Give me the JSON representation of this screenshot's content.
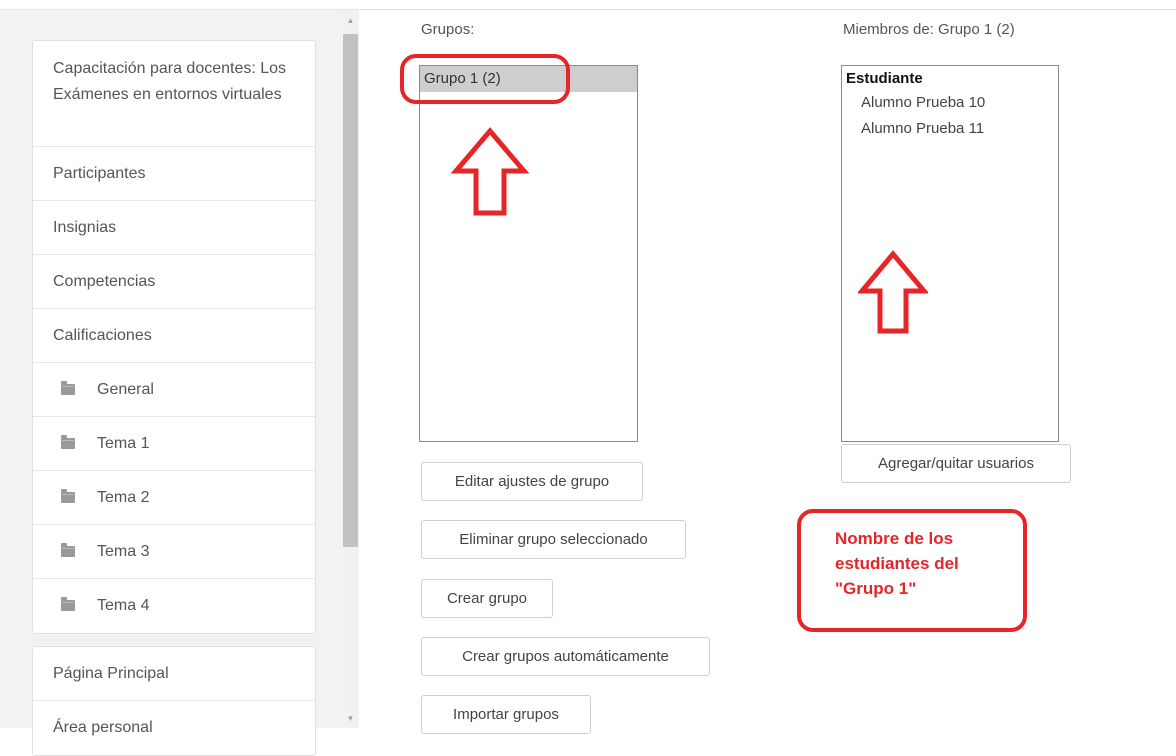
{
  "sidebar": {
    "course_title": "Capacitación para docentes: Los Exámenes en entornos virtuales",
    "items": [
      {
        "label": "Participantes"
      },
      {
        "label": "Insignias"
      },
      {
        "label": "Competencias"
      },
      {
        "label": "Calificaciones"
      }
    ],
    "sections": [
      {
        "label": "General",
        "icon": "folder-icon"
      },
      {
        "label": "Tema 1",
        "icon": "folder-icon"
      },
      {
        "label": "Tema 2",
        "icon": "folder-icon"
      },
      {
        "label": "Tema 3",
        "icon": "folder-icon"
      },
      {
        "label": "Tema 4",
        "icon": "folder-icon"
      }
    ],
    "bottom_items": [
      {
        "label": "Página Principal"
      },
      {
        "label": "Área personal"
      }
    ]
  },
  "groups": {
    "label": "Grupos:",
    "options": [
      {
        "label": "Grupo 1 (2)",
        "selected": true
      }
    ]
  },
  "members": {
    "label": "Miembros de: Grupo 1 (2)",
    "role": "Estudiante",
    "users": [
      "Alumno Prueba 10",
      "Alumno Prueba 11"
    ],
    "add_remove_button": "Agregar/quitar usuarios"
  },
  "buttons": {
    "edit": "Editar ajustes de grupo",
    "delete": "Eliminar grupo seleccionado",
    "create": "Crear grupo",
    "auto_create": "Crear grupos automáticamente",
    "import": "Importar grupos"
  },
  "annotation": {
    "line1": "Nombre de los",
    "line2": "estudiantes del",
    "line3": "\"Grupo 1\"",
    "color": "#e52528"
  },
  "scrollbar": {
    "up_icon": "scroll-up-arrow-icon",
    "down_icon": "scroll-down-arrow-icon"
  }
}
